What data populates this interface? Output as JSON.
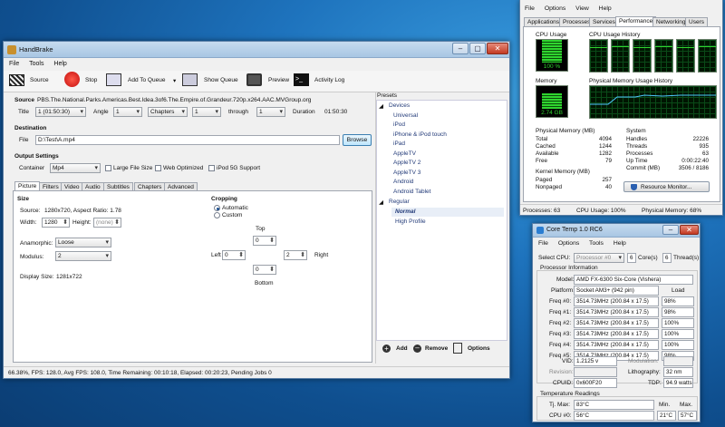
{
  "handbrake": {
    "title": "HandBrake",
    "menu": [
      "File",
      "Tools",
      "Help"
    ],
    "toolbar": {
      "source": "Source",
      "stop": "Stop",
      "add_to_queue": "Add To Queue",
      "show_queue": "Show Queue",
      "preview": "Preview",
      "activity_log": "Activity Log"
    },
    "source": {
      "label": "Source",
      "value": "PBS.The.National.Parks.Americas.Best.Idea.3of6.The.Empire.of.Grandeur.720p.x264.AAC.MVGroup.org",
      "title_label": "Title",
      "title_value": "1 (01:50:30)",
      "angle_label": "Angle",
      "angle_value": "1",
      "mode_value": "Chapters",
      "from_value": "1",
      "through_label": "through",
      "to_value": "1",
      "duration_label": "Duration",
      "duration_value": "01:50:30"
    },
    "destination": {
      "label": "Destination",
      "file_label": "File",
      "file_value": "D:\\Test\\A.mp4",
      "browse": "Browse"
    },
    "output": {
      "label": "Output Settings",
      "container_label": "Container",
      "container_value": "Mp4",
      "large_file": "Large File Size",
      "web_optimized": "Web Optimized",
      "ipod": "iPod 5G Support"
    },
    "tabs": [
      "Picture",
      "Filters",
      "Video",
      "Audio",
      "Subtitles",
      "Chapters",
      "Advanced"
    ],
    "picture": {
      "size_label": "Size",
      "source_label": "Source:",
      "source_value": "1280x720, Aspect Ratio: 1.78",
      "width_label": "Width:",
      "width_value": "1280",
      "height_label": "Height:",
      "height_value": "(none)",
      "anamorphic_label": "Anamorphic:",
      "anamorphic_value": "Loose",
      "modulus_label": "Modulus:",
      "modulus_value": "2",
      "display_label": "Display Size:",
      "display_value": "1281x722",
      "cropping_label": "Cropping",
      "automatic": "Automatic",
      "custom": "Custom",
      "top": "Top",
      "left": "Left",
      "right": "Right",
      "bottom": "Bottom",
      "top_value": "0",
      "left_value": "0",
      "right_value": "2",
      "bottom_value": "0"
    },
    "presets": {
      "label": "Presets",
      "devices": "Devices",
      "device_items": [
        "Universal",
        "iPod",
        "iPhone & iPod touch",
        "iPad",
        "AppleTV",
        "AppleTV 2",
        "AppleTV 3",
        "Android",
        "Android Tablet"
      ],
      "regular": "Regular",
      "regular_items": [
        "Normal",
        "High Profile"
      ],
      "add": "Add",
      "remove": "Remove",
      "options": "Options"
    },
    "status": "66.38%, FPS: 128.0, Avg FPS: 108.0, Time Remaining: 00:10:18, Elapsed: 00:20:23, Pending Jobs 0"
  },
  "taskmgr": {
    "menu": [
      "File",
      "Options",
      "View",
      "Help"
    ],
    "tabs": [
      "Applications",
      "Processes",
      "Services",
      "Performance",
      "Networking",
      "Users"
    ],
    "cpu_usage_label": "CPU Usage",
    "cpu_usage_value": "100 %",
    "cpu_usage_pct": 100,
    "cpu_history_label": "CPU Usage History",
    "memory_label": "Memory",
    "memory_value": "2.74 GB",
    "memory_pct": 68,
    "mem_history_label": "Physical Memory Usage History",
    "phys_label": "Physical Memory (MB)",
    "phys_rows": [
      [
        "Total",
        "4094"
      ],
      [
        "Cached",
        "1244"
      ],
      [
        "Available",
        "1282"
      ],
      [
        "Free",
        "79"
      ]
    ],
    "kernel_label": "Kernel Memory (MB)",
    "kernel_rows": [
      [
        "Paged",
        "257"
      ],
      [
        "Nonpaged",
        "40"
      ]
    ],
    "system_label": "System",
    "system_rows": [
      [
        "Handles",
        "22226"
      ],
      [
        "Threads",
        "935"
      ],
      [
        "Processes",
        "63"
      ],
      [
        "Up Time",
        "0:00:22:40"
      ],
      [
        "Commit (MB)",
        "3506 / 8186"
      ]
    ],
    "resource_monitor": "Resource Monitor...",
    "status": {
      "processes": "Processes: 63",
      "cpu": "CPU Usage: 100%",
      "memory": "Physical Memory: 68%"
    }
  },
  "coretemp": {
    "title": "Core Temp 1.0 RC6",
    "menu": [
      "File",
      "Options",
      "Tools",
      "Help"
    ],
    "select_cpu_label": "Select CPU:",
    "select_cpu_value": "Processor #0",
    "cores_value": "6",
    "cores_label": "Core(s)",
    "threads_value": "6",
    "threads_label": "Thread(s)",
    "proc_info_label": "Processor Information",
    "model_label": "Model:",
    "model_value": "AMD FX-6300 Six-Core (Vishera)",
    "platform_label": "Platform:",
    "platform_value": "Socket AM3+ (942 pin)",
    "load_label": "Load",
    "freqs": [
      [
        "Freq #0:",
        "3514.73MHz (200.84 x 17.5)",
        "98%"
      ],
      [
        "Freq #1:",
        "3514.73MHz (200.84 x 17.5)",
        "98%"
      ],
      [
        "Freq #2:",
        "3514.73MHz (200.84 x 17.5)",
        "100%"
      ],
      [
        "Freq #3:",
        "3514.73MHz (200.84 x 17.5)",
        "100%"
      ],
      [
        "Freq #4:",
        "3514.73MHz (200.84 x 17.5)",
        "100%"
      ],
      [
        "Freq #5:",
        "3514.73MHz (200.84 x 17.5)",
        "98%"
      ]
    ],
    "vid_label": "VID:",
    "vid_value": "1.2125 v",
    "modulation_label": "Modulation:",
    "revision_label": "Revision:",
    "lithography_label": "Lithography:",
    "lithography_value": "32 nm",
    "cpuid_label": "CPUID:",
    "cpuid_value": "0x600F20",
    "tdp_label": "TDP:",
    "tdp_value": "94.9 watts",
    "temp_label": "Temperature Readings",
    "tjmax_label": "Tj. Max:",
    "tjmax_value": "83°C",
    "min_label": "Min.",
    "max_label": "Max.",
    "cpu0_label": "CPU #0:",
    "cpu0_value": "56°C",
    "cpu0_min": "21°C",
    "cpu0_max": "57°C"
  }
}
